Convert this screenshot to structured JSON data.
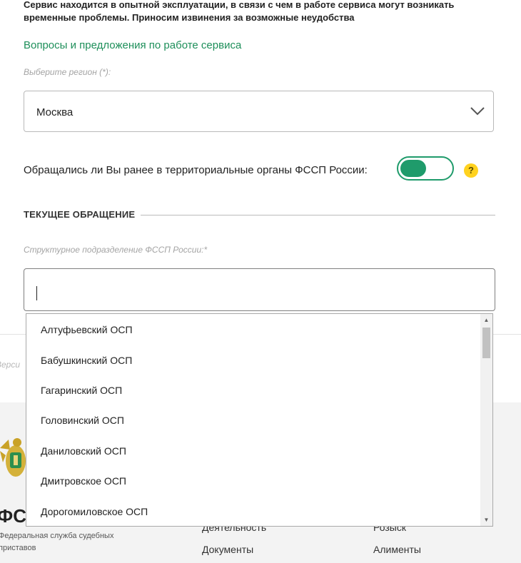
{
  "notice": {
    "line1": "Сервис находится в опытной эксплуатации, в связи с чем в работе сервиса могут возникать",
    "line2": "временные проблемы. Приносим извинения за возможные неудобства"
  },
  "feedback_link": "Вопросы и предложения по работе сервиса",
  "region": {
    "label": "Выберите регион (*):",
    "value": "Москва"
  },
  "previous_appeal": {
    "question": "Обращались ли Вы ранее в территориальные органы ФССП России:",
    "toggle_on": true,
    "help": "?"
  },
  "section_title": "ТЕКУЩЕЕ ОБРАЩЕНИЕ",
  "subdivision": {
    "label": "Структурное подразделение ФССП России:*",
    "value": ""
  },
  "dropdown_options": [
    "Алтуфьевский ОСП",
    "Бабушкинский ОСП",
    "Гагаринский ОСП",
    "Головинский ОСП",
    "Даниловский ОСП",
    "Дмитровское ОСП",
    "Дорогомиловское ОСП"
  ],
  "version_text": "Верси",
  "footer": {
    "brand": "ФС",
    "subtitle_line1": "Федеральная служба судебных",
    "subtitle_line2": "приставов",
    "links_col1": [
      "Деятельность",
      "Документы"
    ],
    "links_col2": [
      "Розыск",
      "Алименты"
    ]
  },
  "colors": {
    "accent": "#1f9b6b",
    "link": "#1e8f5a",
    "help": "#ffd21f",
    "footer_bg": "#f3f3f3"
  },
  "icons": {
    "chevron": "chevron-down-icon",
    "help": "question-icon",
    "emblem": "eagle-emblem-icon"
  }
}
